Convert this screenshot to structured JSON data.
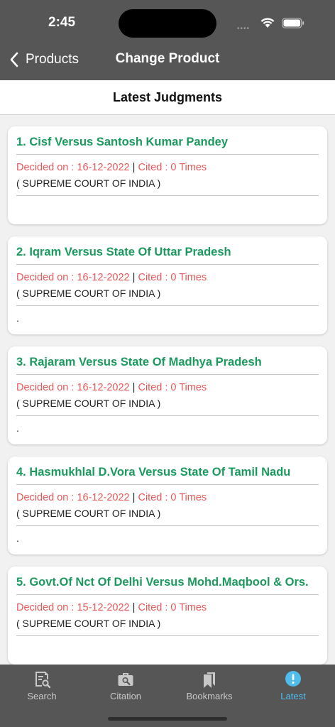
{
  "status": {
    "time": "2:45",
    "dots": "••••"
  },
  "nav": {
    "back_label": "Products",
    "title": "Change Product"
  },
  "section": {
    "title": "Latest Judgments"
  },
  "judgments": [
    {
      "title": "1. Cisf  Versus Santosh Kumar Pandey",
      "decided": "Decided on : 16-12-2022",
      "separator": "|",
      "cited": "Cited : 0 Times",
      "court": "( SUPREME COURT OF INDIA )",
      "snippet": ""
    },
    {
      "title": "2. Iqram  Versus State Of Uttar Pradesh",
      "decided": "Decided on : 16-12-2022",
      "separator": "|",
      "cited": "Cited : 0 Times",
      "court": "( SUPREME COURT OF INDIA )",
      "snippet": "."
    },
    {
      "title": "3. Rajaram  Versus State Of Madhya Pradesh",
      "decided": "Decided on : 16-12-2022",
      "separator": "|",
      "cited": "Cited : 0 Times",
      "court": "( SUPREME COURT OF INDIA )",
      "snippet": "."
    },
    {
      "title": "4. Hasmukhlal D.Vora  Versus State Of Tamil Nadu",
      "decided": "Decided on : 16-12-2022",
      "separator": "|",
      "cited": "Cited : 0 Times",
      "court": "( SUPREME COURT OF INDIA )",
      "snippet": "."
    },
    {
      "title": "5. Govt.Of Nct Of Delhi   Versus Mohd.Maqbool & Ors.",
      "decided": "Decided on : 15-12-2022",
      "separator": "|",
      "cited": "Cited : 0 Times",
      "court": "( SUPREME COURT OF INDIA )",
      "snippet": ""
    }
  ],
  "tabs": [
    {
      "label": "Search",
      "icon": "search-doc-icon"
    },
    {
      "label": "Citation",
      "icon": "briefcase-search-icon"
    },
    {
      "label": "Bookmarks",
      "icon": "bookmarks-icon"
    },
    {
      "label": "Latest",
      "icon": "alert-circle-icon",
      "active": true
    }
  ],
  "colors": {
    "header": "#565656",
    "title_green": "#1c9a5e",
    "meta_red": "#e8585a",
    "active_tab": "#4fbcec"
  }
}
